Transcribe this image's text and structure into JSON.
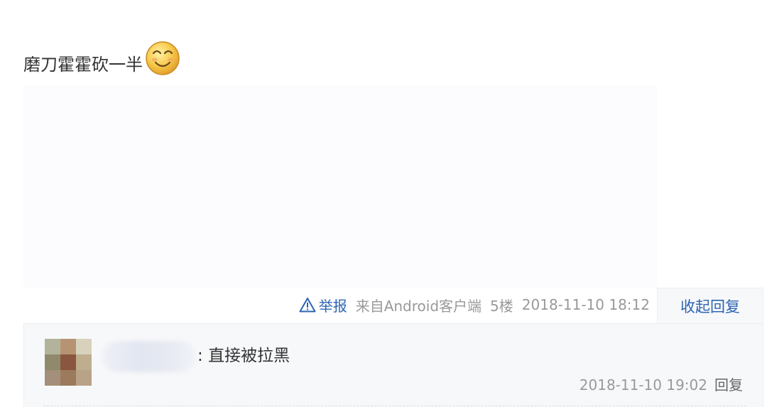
{
  "post": {
    "text": "磨刀霍霍砍一半",
    "emoji": "smiley-face-icon"
  },
  "meta": {
    "report_icon": "warning-triangle-icon",
    "report_label": "举报",
    "source": "来自Android客户端",
    "floor": "5楼",
    "timestamp": "2018-11-10 18:12",
    "collapse_label": "收起回复"
  },
  "reply": {
    "separator": ":",
    "text": "直接被拉黑",
    "timestamp": "2018-11-10 19:02",
    "reply_label": "回复"
  },
  "colors": {
    "link": "#2d64b3",
    "muted": "#999999",
    "panel": "#f7f8fa"
  }
}
